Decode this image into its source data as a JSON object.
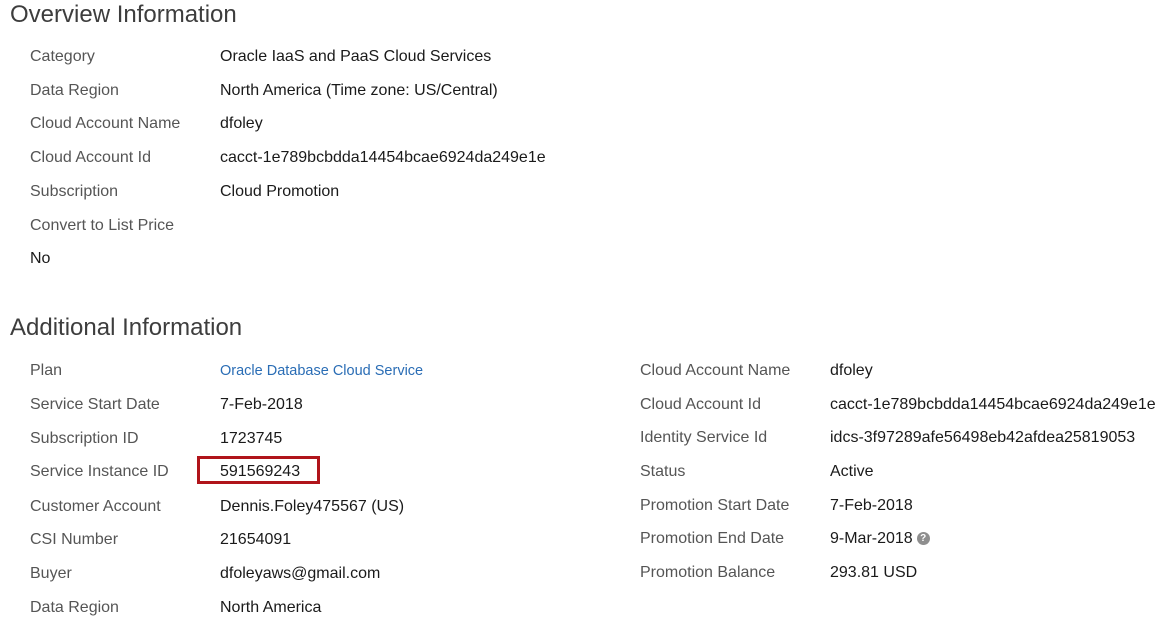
{
  "overview": {
    "title": "Overview Information",
    "rows": [
      {
        "label": "Category",
        "value": "Oracle IaaS and PaaS Cloud Services"
      },
      {
        "label": "Data Region",
        "value": "North America (Time zone: US/Central)"
      },
      {
        "label": "Cloud Account Name",
        "value": "dfoley"
      },
      {
        "label": "Cloud Account Id",
        "value": "cacct-1e789bcbdda14454bcae6924da249e1e"
      },
      {
        "label": "Subscription",
        "value": "Cloud Promotion"
      }
    ],
    "convert_label": "Convert to List Price",
    "convert_value": "No"
  },
  "additional": {
    "title": "Additional Information",
    "left": [
      {
        "label": "Plan",
        "value": "Oracle Database Cloud Service"
      },
      {
        "label": "Service Start Date",
        "value": "7-Feb-2018"
      },
      {
        "label": "Subscription ID",
        "value": "1723745"
      },
      {
        "label": "Service Instance ID",
        "value": "591569243"
      },
      {
        "label": "Customer Account",
        "value": "Dennis.Foley475567 (US)"
      },
      {
        "label": "CSI Number",
        "value": "21654091"
      },
      {
        "label": "Buyer",
        "value": "dfoleyaws@gmail.com"
      },
      {
        "label": "Data Region",
        "value": "North America"
      }
    ],
    "right": [
      {
        "label": "Cloud Account Name",
        "value": "dfoley"
      },
      {
        "label": "Cloud Account Id",
        "value": "cacct-1e789bcbdda14454bcae6924da249e1e"
      },
      {
        "label": "Identity Service Id",
        "value": "idcs-3f97289afe56498eb42afdea25819053"
      },
      {
        "label": "Status",
        "value": "Active"
      },
      {
        "label": "Promotion Start Date",
        "value": "7-Feb-2018"
      },
      {
        "label": "Promotion End Date",
        "value": "9-Mar-2018"
      },
      {
        "label": "Promotion Balance",
        "value": "293.81 USD"
      }
    ],
    "help_icon": "?"
  },
  "colors": {
    "highlight": "#b0141a",
    "link": "#2a6db5"
  }
}
